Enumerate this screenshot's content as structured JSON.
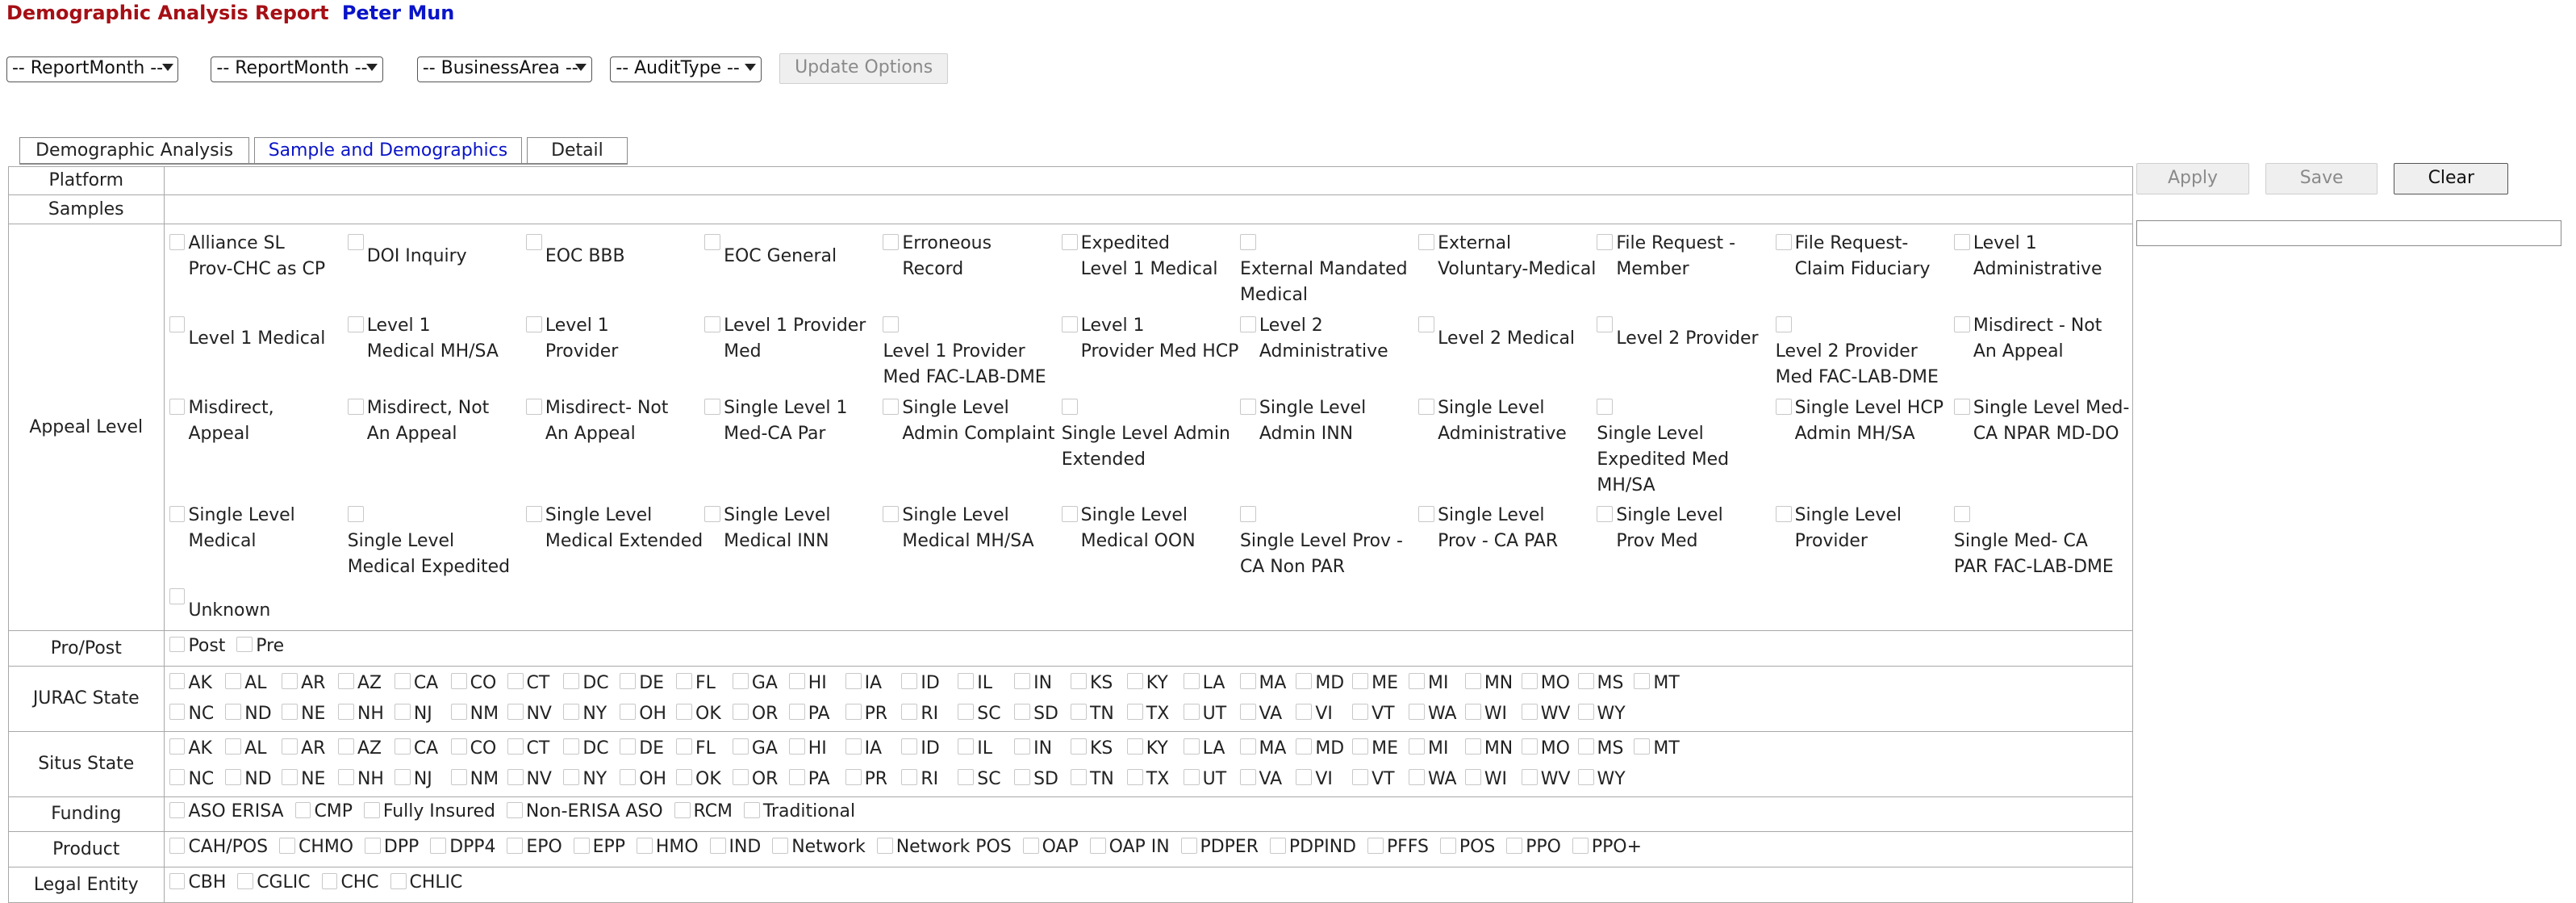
{
  "header": {
    "title": "Demographic Analysis Report",
    "user": "Peter Mun"
  },
  "filters": {
    "report_month_start": "-- ReportMonth --",
    "report_month_end": "-- ReportMonth --",
    "business_area": "-- BusinessArea --",
    "audit_type": "-- AuditType --",
    "update_button": "Update Options"
  },
  "tabs": [
    {
      "label": "Demographic Analysis"
    },
    {
      "label": "Sample and Demographics"
    },
    {
      "label": "Detail"
    }
  ],
  "actions": {
    "apply": "Apply",
    "save": "Save",
    "clear": "Clear",
    "text_value": ""
  },
  "rows": {
    "platform": {
      "label": "Platform"
    },
    "samples": {
      "label": "Samples"
    },
    "appeal_level": {
      "label": "Appeal Level",
      "options": [
        "Alliance SL\nProv-CHC as CP",
        "DOI Inquiry",
        "EOC BBB",
        "EOC General",
        "Erroneous\nRecord",
        "Expedited\nLevel 1 Medical",
        "External Mandated\nMedical",
        "External\nVoluntary-Medical",
        "File Request -\nMember",
        "File Request-\nClaim Fiduciary",
        "Level 1\nAdministrative",
        "Level 1 Medical",
        "Level 1\nMedical MH/SA",
        "Level 1\nProvider",
        "Level 1 Provider\nMed",
        "Level 1 Provider\nMed FAC-LAB-DME",
        "Level 1\nProvider Med HCP",
        "Level 2\nAdministrative",
        "Level 2 Medical",
        "Level 2 Provider",
        "Level 2 Provider\nMed FAC-LAB-DME",
        "Misdirect - Not\nAn Appeal",
        "Misdirect,\nAppeal",
        "Misdirect, Not\nAn Appeal",
        "Misdirect- Not\nAn Appeal",
        "Single Level 1\nMed-CA Par",
        "Single Level\nAdmin Complaint",
        "Single Level Admin\nExtended",
        "Single Level\nAdmin INN",
        "Single Level\nAdministrative",
        "Single Level\nExpedited Med MH/SA",
        "Single Level HCP\nAdmin MH/SA",
        "Single Level Med-\nCA NPAR MD-DO",
        "Single Level\nMedical",
        "Single Level\nMedical Expedited",
        "Single Level\nMedical Extended",
        "Single Level\nMedical INN",
        "Single Level\nMedical MH/SA",
        "Single Level\nMedical OON",
        "Single Level Prov -\nCA Non PAR",
        "Single Level\nProv - CA PAR",
        "Single Level\nProv Med",
        "Single Level\nProvider",
        "Single Med- CA\nPAR FAC-LAB-DME",
        "Unknown"
      ]
    },
    "pro_post": {
      "label": "Pro/Post",
      "options": [
        "Post",
        "Pre"
      ]
    },
    "jurac_state": {
      "label": "JURAC State",
      "row1": [
        "AK",
        "AL",
        "AR",
        "AZ",
        "CA",
        "CO",
        "CT",
        "DC",
        "DE",
        "FL",
        "GA",
        "HI",
        "IA",
        "ID",
        "IL",
        "IN",
        "KS",
        "KY",
        "LA",
        "MA",
        "MD",
        "ME",
        "MI",
        "MN",
        "MO",
        "MS",
        "MT"
      ],
      "row2": [
        "NC",
        "ND",
        "NE",
        "NH",
        "NJ",
        "NM",
        "NV",
        "NY",
        "OH",
        "OK",
        "OR",
        "PA",
        "PR",
        "RI",
        "SC",
        "SD",
        "TN",
        "TX",
        "UT",
        "VA",
        "VI",
        "VT",
        "WA",
        "WI",
        "WV",
        "WY"
      ]
    },
    "situs_state": {
      "label": "Situs State",
      "row1": [
        "AK",
        "AL",
        "AR",
        "AZ",
        "CA",
        "CO",
        "CT",
        "DC",
        "DE",
        "FL",
        "GA",
        "HI",
        "IA",
        "ID",
        "IL",
        "IN",
        "KS",
        "KY",
        "LA",
        "MA",
        "MD",
        "ME",
        "MI",
        "MN",
        "MO",
        "MS",
        "MT"
      ],
      "row2": [
        "NC",
        "ND",
        "NE",
        "NH",
        "NJ",
        "NM",
        "NV",
        "NY",
        "OH",
        "OK",
        "OR",
        "PA",
        "PR",
        "RI",
        "SC",
        "SD",
        "TN",
        "TX",
        "UT",
        "VA",
        "VI",
        "VT",
        "WA",
        "WI",
        "WV",
        "WY"
      ]
    },
    "funding": {
      "label": "Funding",
      "options": [
        "ASO ERISA",
        "CMP",
        "Fully Insured",
        "Non-ERISA ASO",
        "RCM",
        "Traditional"
      ]
    },
    "product": {
      "label": "Product",
      "options": [
        "CAH/POS",
        "CHMO",
        "DPP",
        "DPP4",
        "EPO",
        "EPP",
        "HMO",
        "IND",
        "Network",
        "Network POS",
        "OAP",
        "OAP IN",
        "PDPER",
        "PDPIND",
        "PFFS",
        "POS",
        "PPO",
        "PPO+"
      ]
    },
    "legal_entity": {
      "label": "Legal Entity",
      "options": [
        "CBH",
        "CGLIC",
        "CHC",
        "CHLIC"
      ]
    }
  }
}
